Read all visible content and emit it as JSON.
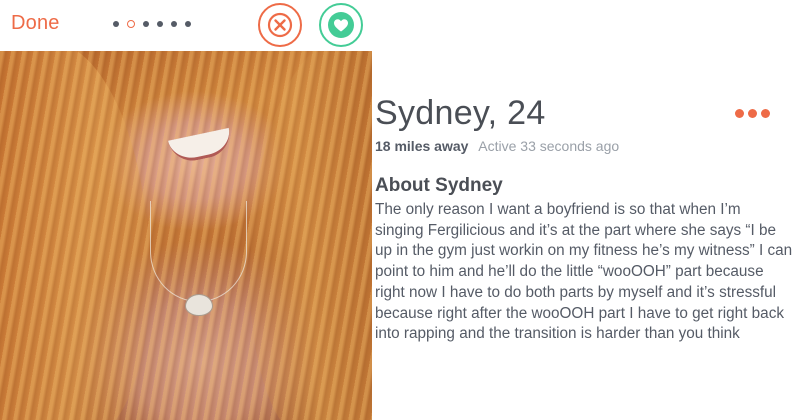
{
  "topbar": {
    "done_label": "Done",
    "photo_count": 6,
    "active_photo_index": 1
  },
  "profile": {
    "name_age": "Sydney, 24",
    "distance": "18 miles away",
    "active_status": "Active 33 seconds ago",
    "about_heading": "About Sydney",
    "bio": "The only reason I want a boyfriend is so that when I’m singing Fergilicious and it’s at the part where she says “I be up in the gym just workin on my fitness he’s my witness” I can point to him and he’ll do the little “wooOOH” part because right now I have to do both parts by myself and it’s stressful because right after the wooOOH part I have to get right back into rapping and the transition is harder than you think"
  },
  "icons": {
    "nope": "close-icon",
    "like": "heart-icon",
    "more": "more-options-icon"
  },
  "colors": {
    "accent": "#ee6b47",
    "like": "#44cc96",
    "text_dark": "#4a4e55",
    "text_muted": "#9aa0a8"
  }
}
